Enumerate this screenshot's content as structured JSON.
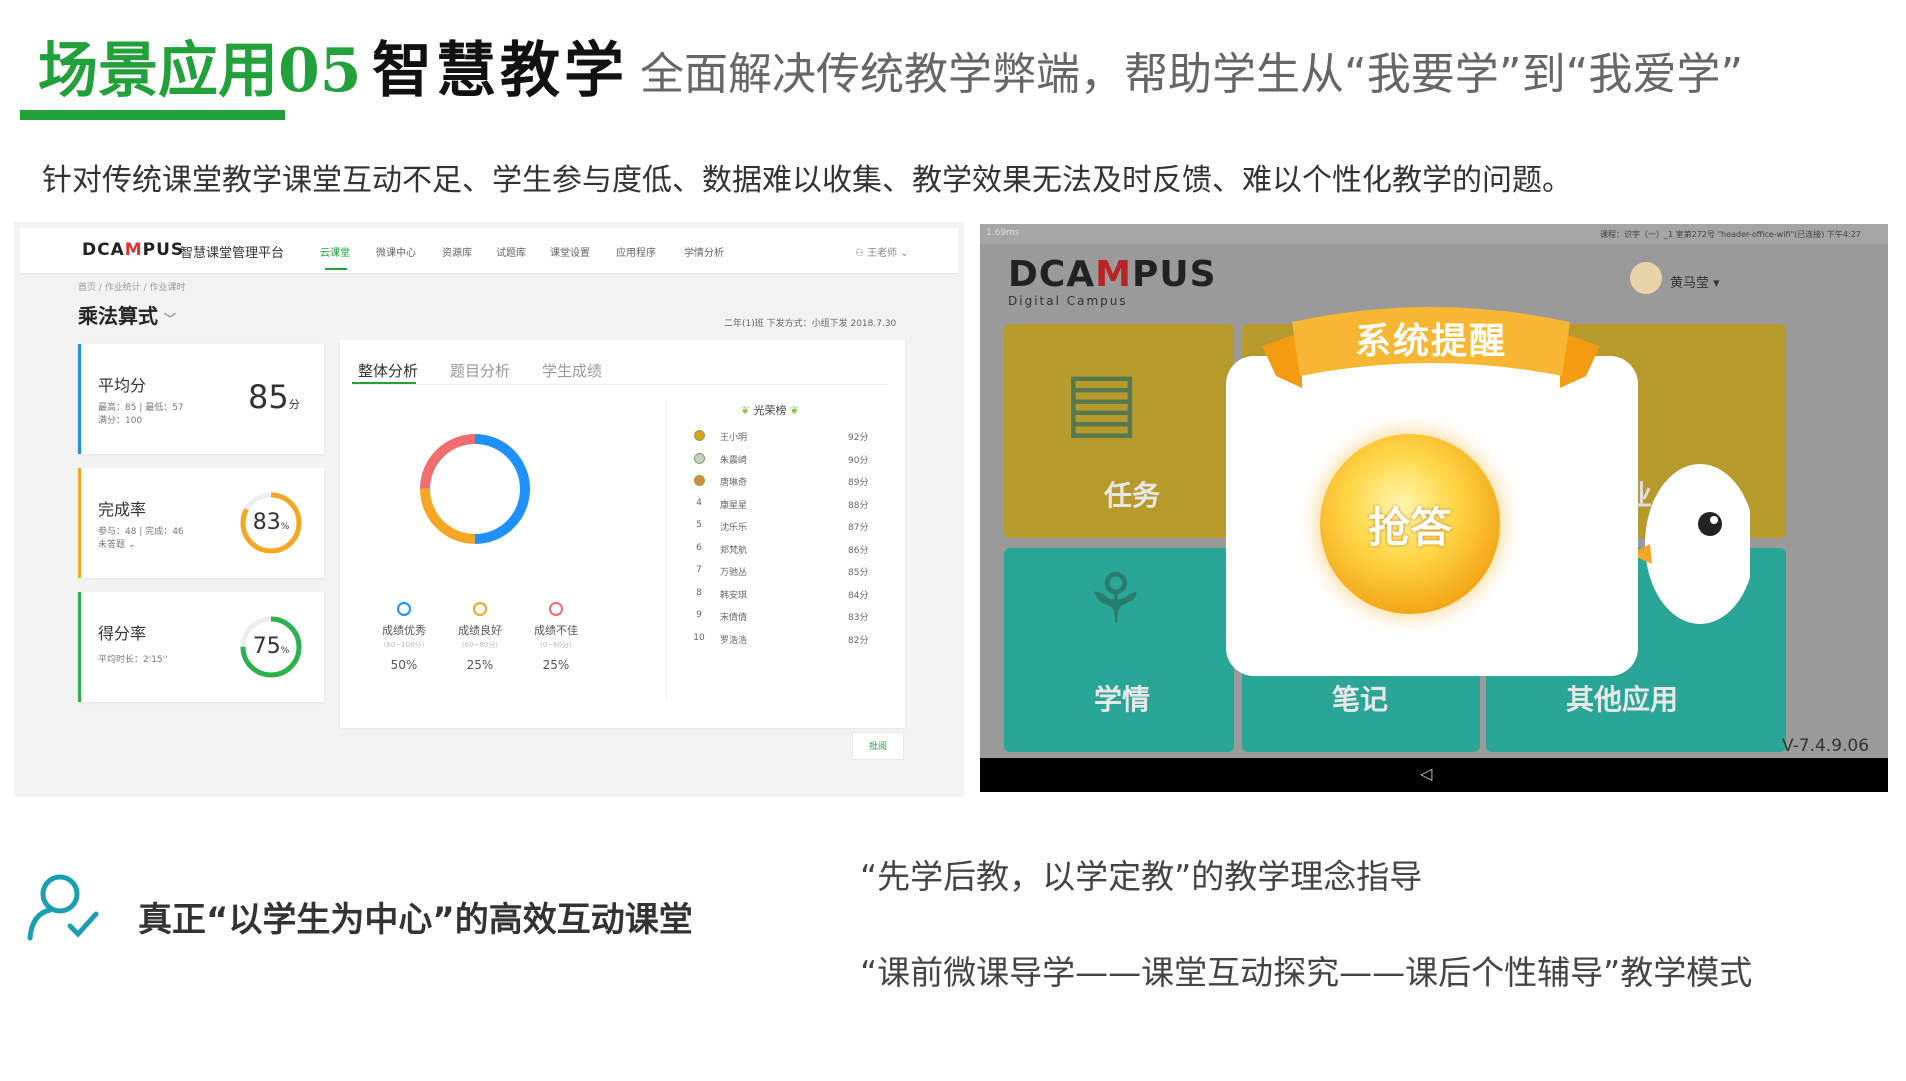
{
  "header": {
    "green_title": "场景应用05",
    "black_title": "智慧教学",
    "subtitle": "全面解决传统教学弊端，帮助学生从“我要学”到“我爱学”",
    "accent_color": "#22a03a"
  },
  "intro": "针对传统课堂教学课堂互动不足、学生参与度低、数据难以收集、教学效果无法及时反馈、难以个性化教学的问题。",
  "left_screen": {
    "logo": {
      "pre": "DCA",
      "mid": "M",
      "post": "PUS"
    },
    "platform": "智慧课堂管理平台",
    "nav": [
      "云课堂",
      "微课中心",
      "资源库",
      "试题库",
      "课堂设置",
      "应用程序",
      "学情分析"
    ],
    "user": "王老师",
    "breadcrumb": "首页 / 作业统计 / 作业课时",
    "page_title": "乘法算式",
    "page_info": "二年(1)班  下发方式：小组下发  2018.7.30",
    "kpi": {
      "avg": {
        "label": "平均分",
        "sub1": "最高：85 | 最低：57",
        "sub2": "满分：100",
        "value": "85",
        "unit": "分",
        "color": "#1e90e0"
      },
      "completion": {
        "label": "完成率",
        "sub1": "参与：48 | 完成：46",
        "sub2": "未答题 ⌄",
        "value": "83",
        "unit": "%",
        "percent": 83,
        "color": "#f5a623"
      },
      "score": {
        "label": "得分率",
        "sub1": "平均时长：2'15''",
        "value": "75",
        "unit": "%",
        "percent": 75,
        "color": "#2bb24c"
      }
    },
    "tabs": [
      "整体分析",
      "题目分析",
      "学生成绩"
    ],
    "donut": [
      {
        "label": "成绩优秀",
        "range": "(80~100分)",
        "percent": 50,
        "display": "50%",
        "color": "#1e90ff"
      },
      {
        "label": "成绩良好",
        "range": "(60~80分)",
        "percent": 25,
        "display": "25%",
        "color": "#f5a623"
      },
      {
        "label": "成绩不佳",
        "range": "(0~60分)",
        "percent": 25,
        "display": "25%",
        "color": "#f26d6d"
      }
    ],
    "rank_title": "光荣榜",
    "ranks": [
      {
        "index": "",
        "medal": "gold",
        "name": "王小明",
        "score": "92分"
      },
      {
        "index": "",
        "medal": "silver",
        "name": "朱震崎",
        "score": "90分"
      },
      {
        "index": "",
        "medal": "bronze",
        "name": "唐琳奇",
        "score": "89分"
      },
      {
        "index": "4",
        "name": "康星星",
        "score": "88分"
      },
      {
        "index": "5",
        "name": "沈乐乐",
        "score": "87分"
      },
      {
        "index": "6",
        "name": "郑梵航",
        "score": "86分"
      },
      {
        "index": "7",
        "name": "万驰丛",
        "score": "85分"
      },
      {
        "index": "8",
        "name": "韩安琪",
        "score": "84分"
      },
      {
        "index": "9",
        "name": "宋倩倩",
        "score": "83分"
      },
      {
        "index": "10",
        "name": "罗浩浩",
        "score": "82分"
      }
    ],
    "more": "批阅"
  },
  "right_screen": {
    "topbar_left": "1.69ms",
    "topbar_right": "课程：识字（一）_1  室第272号  \"header-office-wifi\"(已连接)  下午4:27",
    "logo": {
      "pre": "DCA",
      "mid": "M",
      "post": "PUS"
    },
    "logo_sub": "Digital Campus",
    "user": "黄马莹 ▾",
    "tiles": [
      "任务",
      "作业",
      "学情",
      "笔记",
      "其他应用"
    ],
    "popup_title": "系统提醒",
    "orb_text": "抢答",
    "version": "V-7.4.9.06",
    "back": "◁"
  },
  "bottom": {
    "left_text": "真正“以学生为中心”的高效互动课堂",
    "quote1": "“先学后教，以学定教”的教学理念指导",
    "quote2": "“课前微课导学——课堂互动探究——课后个性辅导”教学模式"
  }
}
